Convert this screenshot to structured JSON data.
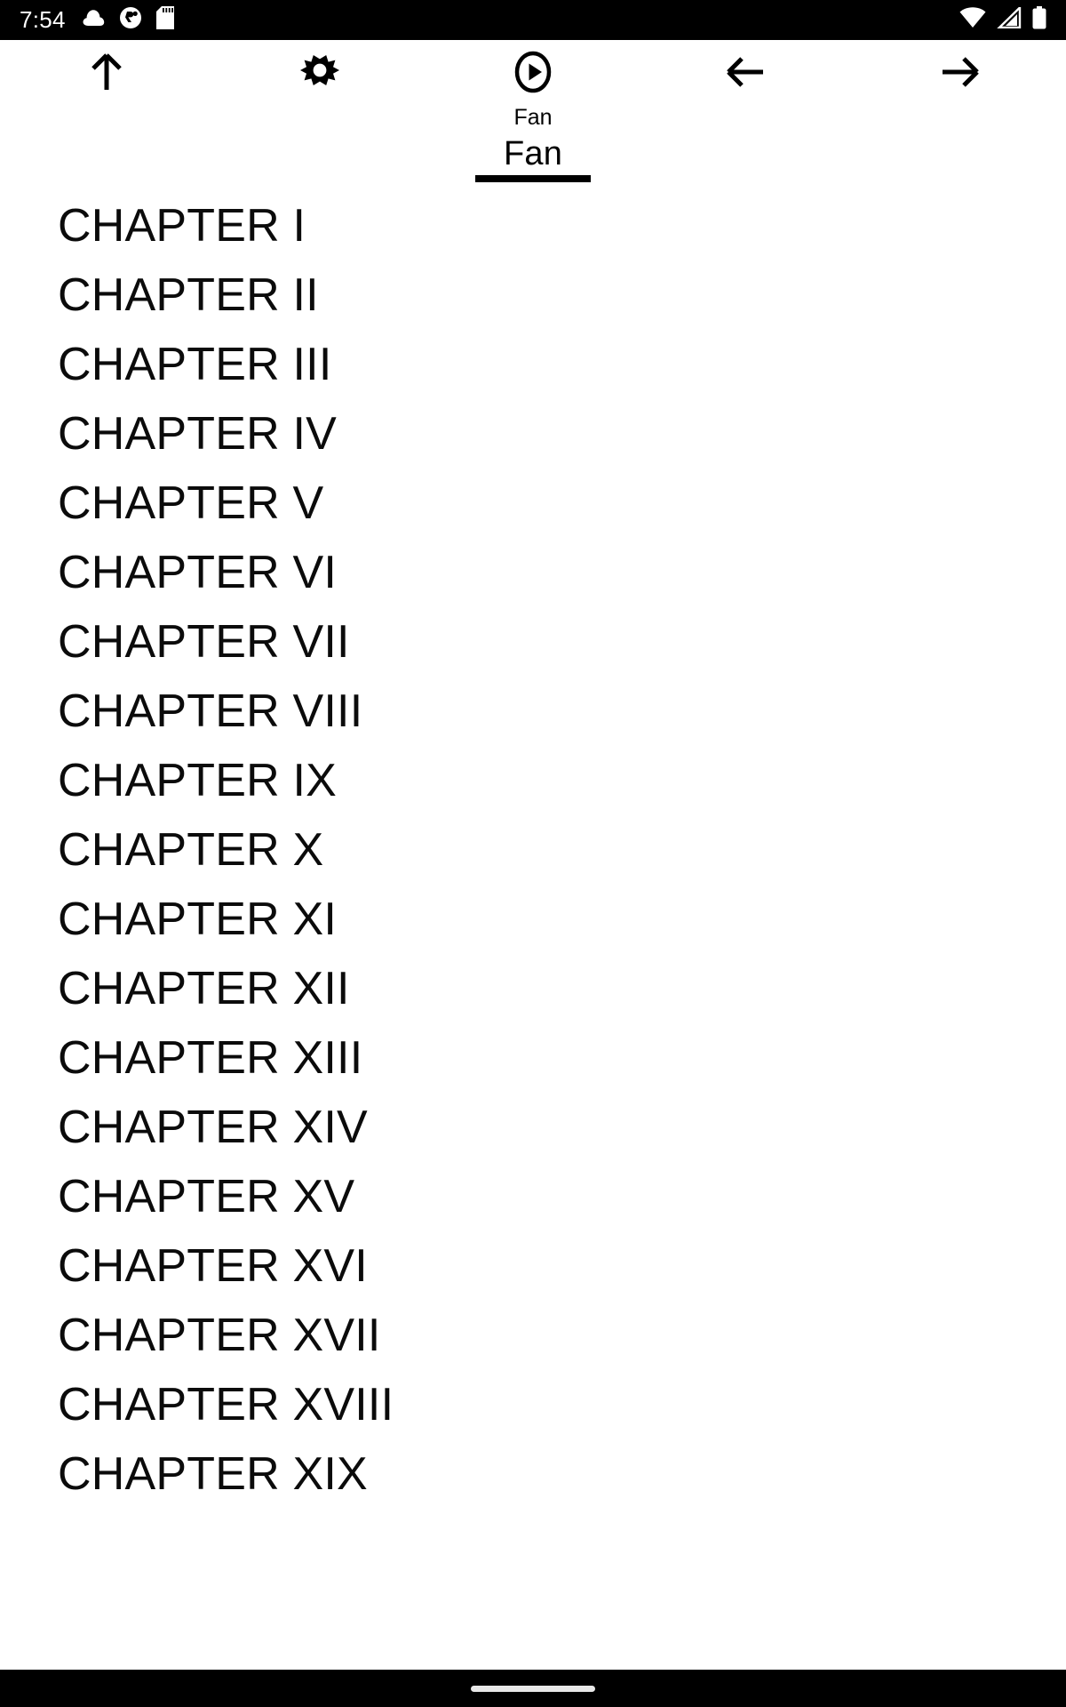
{
  "status_bar": {
    "time": "7:54",
    "left_icons": [
      "cloud-icon",
      "circle-notification-icon",
      "sd-card-icon"
    ],
    "right_icons": [
      "wifi-icon",
      "cellular-signal-icon",
      "battery-icon"
    ],
    "background_color": "#000000",
    "foreground_color": "#ffffff"
  },
  "toolbar": {
    "buttons": [
      {
        "name": "scroll-to-top-button",
        "icon": "arrow-up-icon"
      },
      {
        "name": "settings-button",
        "icon": "gear-icon"
      },
      {
        "name": "play-button",
        "icon": "play-circle-icon"
      },
      {
        "name": "previous-button",
        "icon": "arrow-left-icon"
      },
      {
        "name": "next-button",
        "icon": "arrow-right-icon"
      }
    ]
  },
  "tab_bar": {
    "subtitle": "Fan",
    "active_tab": "Fan",
    "indicator_color": "#000000"
  },
  "chapter_list": {
    "items": [
      "CHAPTER I",
      "CHAPTER II",
      "CHAPTER III",
      "CHAPTER IV",
      "CHAPTER V",
      "CHAPTER VI",
      "CHAPTER VII",
      "CHAPTER VIII",
      "CHAPTER IX",
      "CHAPTER X",
      "CHAPTER XI",
      "CHAPTER XII",
      "CHAPTER XIII",
      "CHAPTER XIV",
      "CHAPTER XV",
      "CHAPTER XVI",
      "CHAPTER XVII",
      "CHAPTER XVIII",
      "CHAPTER XIX"
    ],
    "text_color": "#0b0b0b",
    "background_color": "#ffffff"
  },
  "navigation_bar": {
    "gesture_pill": "home-gesture-pill",
    "background_color": "#000000",
    "pill_color": "#e8e8e8"
  }
}
